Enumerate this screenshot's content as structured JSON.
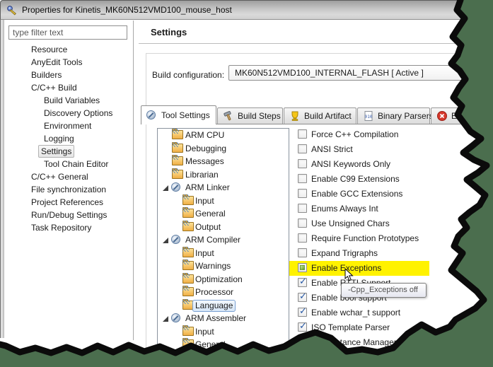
{
  "window": {
    "title": "Properties for Kinetis_MK60N512VMD100_mouse_host"
  },
  "sidebar": {
    "filter_text": "type filter text",
    "items": [
      {
        "label": "Resource"
      },
      {
        "label": "AnyEdit Tools"
      },
      {
        "label": "Builders"
      },
      {
        "label": "C/C++ Build"
      },
      {
        "label": "Build Variables"
      },
      {
        "label": "Discovery Options"
      },
      {
        "label": "Environment"
      },
      {
        "label": "Logging"
      },
      {
        "label": "Settings",
        "state": "selected"
      },
      {
        "label": "Tool Chain Editor"
      },
      {
        "label": "C/C++ General"
      },
      {
        "label": "File synchronization"
      },
      {
        "label": "Project References"
      },
      {
        "label": "Run/Debug Settings"
      },
      {
        "label": "Task Repository"
      }
    ]
  },
  "main": {
    "heading": "Settings",
    "build_config": {
      "label": "Build configuration:",
      "value": "MK60N512VMD100_INTERNAL_FLASH [ Active ]"
    },
    "tabs": [
      {
        "label": "Tool Settings",
        "state": "active"
      },
      {
        "label": "Build Steps"
      },
      {
        "label": "Build Artifact"
      },
      {
        "label": "Binary Parsers"
      },
      {
        "label": "Erro"
      }
    ],
    "tool_tree": [
      {
        "label": "ARM CPU"
      },
      {
        "label": "Debugging"
      },
      {
        "label": "Messages"
      },
      {
        "label": "Librarian"
      },
      {
        "label": "ARM Linker",
        "state": "expanded"
      },
      {
        "label": "Input"
      },
      {
        "label": "General"
      },
      {
        "label": "Output"
      },
      {
        "label": "ARM Compiler",
        "state": "expanded"
      },
      {
        "label": "Input"
      },
      {
        "label": "Warnings"
      },
      {
        "label": "Optimization"
      },
      {
        "label": "Processor"
      },
      {
        "label": "Language",
        "state": "selected"
      },
      {
        "label": "ARM Assembler",
        "state": "expanded"
      },
      {
        "label": "Input"
      },
      {
        "label": "General"
      }
    ],
    "options": [
      {
        "label": "Force C++ Compilation",
        "state": "unchecked"
      },
      {
        "label": "ANSI Strict",
        "state": "unchecked"
      },
      {
        "label": "ANSI Keywords Only",
        "state": "unchecked"
      },
      {
        "label": "Enable C99 Extensions",
        "state": "unchecked"
      },
      {
        "label": "Enable GCC Extensions",
        "state": "unchecked"
      },
      {
        "label": "Enums Always Int",
        "state": "unchecked"
      },
      {
        "label": "Use Unsigned Chars",
        "state": "unchecked"
      },
      {
        "label": "Require Function Prototypes",
        "state": "unchecked"
      },
      {
        "label": "Expand Trigraphs",
        "state": "unchecked"
      },
      {
        "label": "Enable Exceptions",
        "state": "partial",
        "highlighted": true
      },
      {
        "label": "Enable RTTI Support",
        "state": "checked"
      },
      {
        "label": "Enable bool support",
        "state": "checked"
      },
      {
        "label": "Enable wchar_t support",
        "state": "checked"
      },
      {
        "label": "ISO Template Parser",
        "state": "checked"
      },
      {
        "label": "Use Instance Manager",
        "state": "unchecked"
      }
    ],
    "tooltip": "-Cpp_Exceptions off"
  },
  "colors": {
    "highlight_yellow": "#fff200",
    "torn_background_green": "#4b6e4e",
    "selection_blue_border": "#7aa1d2",
    "check_blue": "#2456a4",
    "partial_green": "#62a026"
  }
}
